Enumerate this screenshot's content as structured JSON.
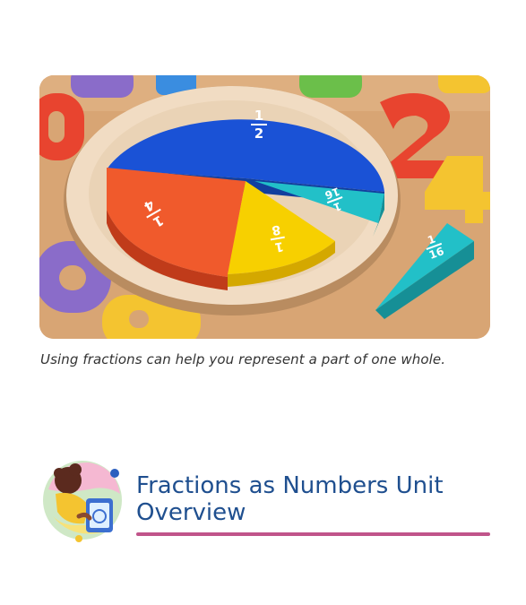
{
  "photo": {
    "fractions": {
      "half": {
        "num": "1",
        "den": "2"
      },
      "quarter": {
        "num": "1",
        "den": "4"
      },
      "eighth": {
        "num": "1",
        "den": "8"
      },
      "sixteenth_a": {
        "num": "1",
        "den": "16"
      },
      "sixteenth_b": {
        "num": "1",
        "den": "16"
      }
    }
  },
  "caption": "Using fractions can help you represent a part of one whole.",
  "section": {
    "title_line1": "Fractions as Numbers Unit",
    "title_line2": "Overview"
  },
  "colors": {
    "title": "#1f4f8f",
    "rule": "#c0548a"
  }
}
